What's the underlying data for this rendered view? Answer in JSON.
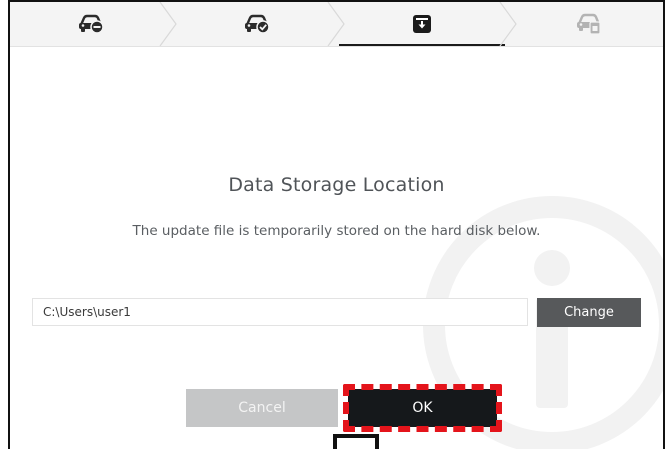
{
  "stepper": {
    "steps": [
      {
        "icon": "car-minus-icon",
        "state": "done"
      },
      {
        "icon": "car-check-icon",
        "state": "done"
      },
      {
        "icon": "download-box-icon",
        "state": "active"
      },
      {
        "icon": "car-device-icon",
        "state": "pending"
      }
    ]
  },
  "dialog": {
    "title": "Data Storage Location",
    "description": "The update file is temporarily stored on the hard disk below."
  },
  "storage": {
    "path_value": "C:\\Users\\user1",
    "change_label": "Change"
  },
  "actions": {
    "cancel_label": "Cancel",
    "ok_label": "OK"
  },
  "colors": {
    "header_bg": "#f4f4f4",
    "change_bg": "#57595b",
    "cancel_bg": "#c5c6c7",
    "ok_bg": "#15181b",
    "highlight": "#e4141b"
  }
}
